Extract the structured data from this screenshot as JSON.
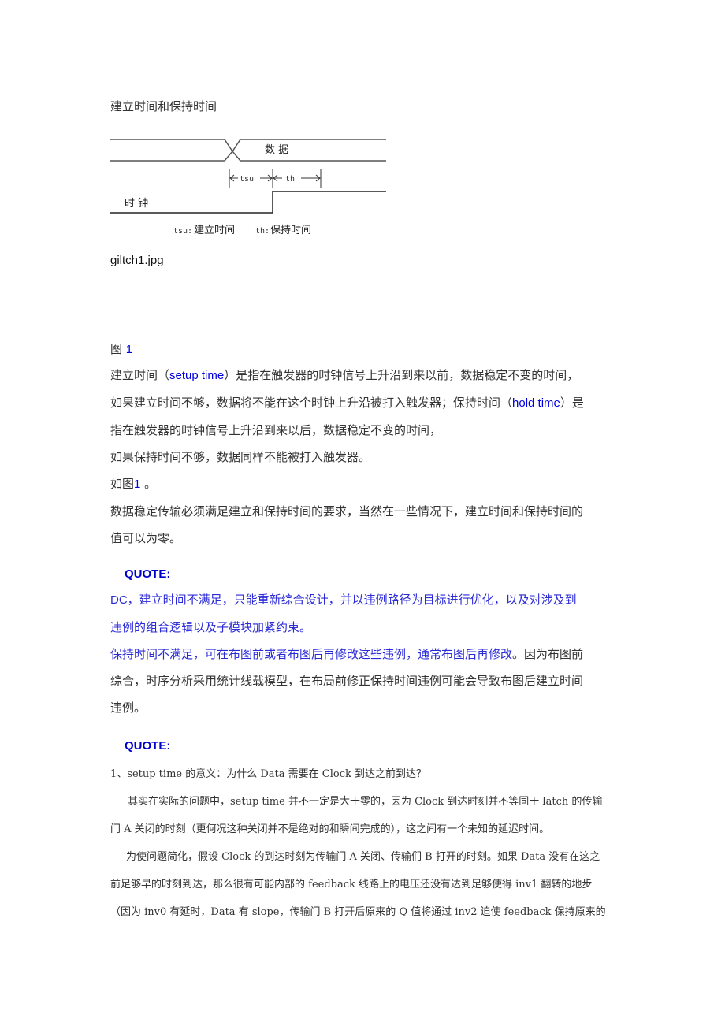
{
  "document": {
    "title": "建立时间和保持时间",
    "diagram": {
      "data_label": "数 据",
      "clock_label": "时 钟",
      "tsu_label": "tsu",
      "th_label": "th",
      "legend_tsu_key": "tsu:",
      "legend_tsu_text": "建立时间",
      "legend_th_key": "th:",
      "legend_th_text": "保持时间"
    },
    "image_caption": "giltch1.jpg",
    "figure_label_prefix": "图",
    "figure_label_number": "1",
    "paragraph1": {
      "l1_a": "建立时间（",
      "l1_b": "setup time",
      "l1_c": "）是指在触发器的时钟信号上升沿到来以前，数据稳定不变的时间，",
      "l2_a": "如果建立时间不够，数据将不能在这个时钟上升沿被打入触发器；保持时间（",
      "l2_b": "hold time",
      "l2_c": "）是",
      "l3": "指在触发器的时钟信号上升沿到来以后，数据稳定不变的时间，",
      "l4": "如果保持时间不够，数据同样不能被打入触发器。",
      "l5_a": "如图",
      "l5_b": "1",
      "l5_c": " 。",
      "l6": "数据稳定传输必须满足建立和保持时间的要求，当然在一些情况下，建立时间和保持时间的",
      "l7": "值可以为零。"
    },
    "quote1": {
      "label": "QUOTE:",
      "l1": "DC，建立时间不满足，只能重新综合设计，并以违例路径为目标进行优化，以及对涉及到",
      "l2": "违例的组合逻辑以及子模块加紧约束。",
      "l3_blue": "保持时间不满足，可在布图前或者布图后再修改这些违例，通常布图后再修改",
      "l3_black": "。因为布图前",
      "l4": "综合，时序分析采用统计线载模型，在布局前修正保持时间违例可能会导致布图后建立时间",
      "l5": "违例。"
    },
    "quote2": {
      "label": "QUOTE:",
      "heading": "1、setup time 的意义：为什么 Data 需要在 Clock 到达之前到达？",
      "p1_l1": "其实在实际的问题中，setup time 并不一定是大于零的，因为 Clock 到达时刻并不等同于 latch 的传输",
      "p1_l2": "门 A 关闭的时刻（更何况这种关闭并不是绝对的和瞬间完成的），这之间有一个未知的延迟时间。",
      "p2_l1": "为使问题简化，假设 Clock 的到达时刻为传输门 A 关闭、传输们 B 打开的时刻。如果 Data 没有在这之",
      "p2_l2": "前足够早的时刻到达，那么很有可能内部的 feedback 线路上的电压还没有达到足够使得 inv1 翻转的地步",
      "p2_l3": "（因为 inv0 有延时，Data 有 slope，传输门 B 打开后原来的 Q 值将通过 inv2 迫使 feedback 保持原来的"
    }
  }
}
